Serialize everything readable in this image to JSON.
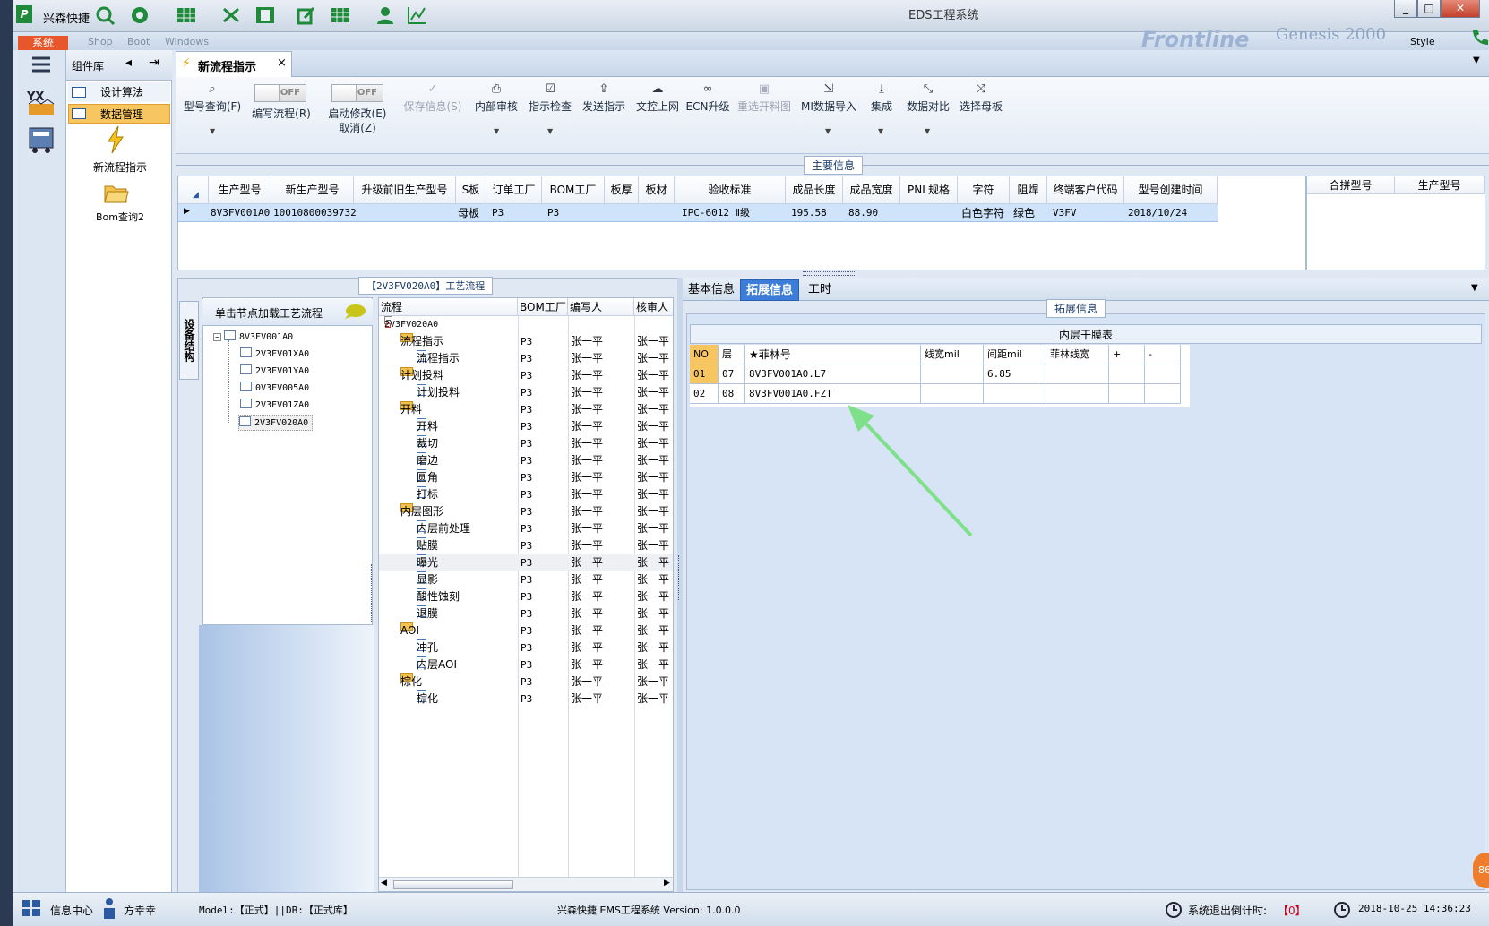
{
  "app": {
    "logo": "P",
    "name": "兴森快捷",
    "window_title": "EDS工程系统",
    "ribbon_tab": "系统",
    "ribbon_menu": [
      "Shop",
      "Boot",
      "Windows"
    ],
    "brand_text": "Frontline",
    "genesis": "Genesis 2000",
    "style_label": "Style",
    "window_buttons": [
      "_",
      "□",
      "✕"
    ]
  },
  "nav": {
    "library_title": "组件库",
    "items": [
      {
        "label": "设计算法",
        "selected": false
      },
      {
        "label": "数据管理",
        "selected": true
      }
    ],
    "tools": [
      {
        "label": "新流程指示",
        "icon": "lightning-icon"
      },
      {
        "label": "Bom查询2",
        "icon": "folder-open-icon"
      }
    ]
  },
  "doc_tab": {
    "label": "新流程指示",
    "close": "×"
  },
  "toolbar": {
    "model_query": "型号查询(F)",
    "edit_flow": "编写流程(R)",
    "enable_modify": "启动修改(E)",
    "cancel": "取消(Z)",
    "toggle_off": "OFF",
    "save_info": "保存信息(S)",
    "internal_review": "内部审核",
    "instruction_check": "指示检查",
    "send_instruction": "发送指示",
    "doc_upload": "文控上网",
    "ecn_upgrade": "ECN升级",
    "reselect_chart": "重选开料图",
    "mi_import": "MI数据导入",
    "integrate": "集成",
    "data_compare": "数据对比",
    "select_master": "选择母板"
  },
  "main_info": {
    "title": "主要信息",
    "columns": [
      "生产型号",
      "新生产型号",
      "升级前旧生产型号",
      "S板",
      "订单工厂",
      "BOM工厂",
      "板厚",
      "板材",
      "验收标准",
      "成品长度",
      "成品宽度",
      "PNL规格",
      "字符",
      "阻焊",
      "终端客户代码",
      "型号创建时间"
    ],
    "row": [
      "8V3FV001A0",
      "10010800039732",
      "",
      "母板",
      "P3",
      "P3",
      "",
      "",
      "IPC-6012 Ⅱ级",
      "195.58",
      "88.90",
      "",
      "白色字符",
      "绿色",
      "V3FV",
      "2018/10/24"
    ],
    "side_columns": [
      "合拼型号",
      "生产型号"
    ]
  },
  "process_flow": {
    "title": "【2V3FV020A0】工艺流程",
    "vertical_tab": "设备结构",
    "load_hint": "单击节点加载工艺流程",
    "tree1": {
      "root": "8V3FV001A0",
      "children": [
        "2V3FV01XA0",
        "2V3FV01YA0",
        "0V3FV005A0",
        "2V3FV01ZA0",
        "2V3FV020A0"
      ]
    },
    "tree2_columns": [
      "流程",
      "BOM工厂",
      "编写人",
      "核审人"
    ],
    "tree2_rows": [
      {
        "name": "2V3FV020A0",
        "level": 0,
        "type": "home",
        "factory": "",
        "writer": "",
        "reviewer": ""
      },
      {
        "name": "流程指示",
        "level": 1,
        "type": "folder",
        "factory": "P3",
        "writer": "张一平",
        "reviewer": "张一平"
      },
      {
        "name": "流程指示",
        "level": 2,
        "type": "doc",
        "factory": "P3",
        "writer": "张一平",
        "reviewer": "张一平"
      },
      {
        "name": "计划投料",
        "level": 1,
        "type": "folder",
        "factory": "P3",
        "writer": "张一平",
        "reviewer": "张一平"
      },
      {
        "name": "计划投料",
        "level": 2,
        "type": "doc",
        "factory": "P3",
        "writer": "张一平",
        "reviewer": "张一平"
      },
      {
        "name": "开料",
        "level": 1,
        "type": "folder",
        "factory": "P3",
        "writer": "张一平",
        "reviewer": "张一平"
      },
      {
        "name": "开料",
        "level": 2,
        "type": "doc",
        "factory": "P3",
        "writer": "张一平",
        "reviewer": "张一平"
      },
      {
        "name": "裁切",
        "level": 2,
        "type": "doc",
        "factory": "P3",
        "writer": "张一平",
        "reviewer": "张一平"
      },
      {
        "name": "磨边",
        "level": 2,
        "type": "doc",
        "factory": "P3",
        "writer": "张一平",
        "reviewer": "张一平"
      },
      {
        "name": "圆角",
        "level": 2,
        "type": "doc",
        "factory": "P3",
        "writer": "张一平",
        "reviewer": "张一平"
      },
      {
        "name": "打标",
        "level": 2,
        "type": "doc",
        "factory": "P3",
        "writer": "张一平",
        "reviewer": "张一平"
      },
      {
        "name": "内层图形",
        "level": 1,
        "type": "folder",
        "factory": "P3",
        "writer": "张一平",
        "reviewer": "张一平"
      },
      {
        "name": "内层前处理",
        "level": 2,
        "type": "doc",
        "factory": "P3",
        "writer": "张一平",
        "reviewer": "张一平"
      },
      {
        "name": "贴膜",
        "level": 2,
        "type": "doc",
        "factory": "P3",
        "writer": "张一平",
        "reviewer": "张一平"
      },
      {
        "name": "曝光",
        "level": 2,
        "type": "doc",
        "factory": "P3",
        "writer": "张一平",
        "reviewer": "张一平"
      },
      {
        "name": "显影",
        "level": 2,
        "type": "doc",
        "factory": "P3",
        "writer": "张一平",
        "reviewer": "张一平"
      },
      {
        "name": "酸性蚀刻",
        "level": 2,
        "type": "doc",
        "factory": "P3",
        "writer": "张一平",
        "reviewer": "张一平"
      },
      {
        "name": "退膜",
        "level": 2,
        "type": "doc",
        "factory": "P3",
        "writer": "张一平",
        "reviewer": "张一平"
      },
      {
        "name": "AOI",
        "level": 1,
        "type": "folder",
        "factory": "P3",
        "writer": "张一平",
        "reviewer": "张一平"
      },
      {
        "name": "冲孔",
        "level": 2,
        "type": "doc",
        "factory": "P3",
        "writer": "张一平",
        "reviewer": "张一平"
      },
      {
        "name": "内层AOI",
        "level": 2,
        "type": "doc",
        "factory": "P3",
        "writer": "张一平",
        "reviewer": "张一平"
      },
      {
        "name": "棕化",
        "level": 1,
        "type": "folder",
        "factory": "P3",
        "writer": "张一平",
        "reviewer": "张一平"
      },
      {
        "name": "棕化",
        "level": 2,
        "type": "doc",
        "factory": "P3",
        "writer": "张一平",
        "reviewer": "张一平"
      }
    ]
  },
  "right_panel": {
    "tabs": [
      "基本信息",
      "拓展信息",
      "工时"
    ],
    "active_tab": "拓展信息",
    "group_title": "拓展信息",
    "table_title": "内层干膜表",
    "columns": [
      "NO",
      "层",
      "★菲林号",
      "线宽mil",
      "间距mil",
      "菲林线宽",
      "+",
      "-"
    ],
    "rows": [
      [
        "01",
        "07",
        "8V3FV001A0.L7",
        "",
        "6.85",
        "",
        "",
        ""
      ],
      [
        "02",
        "08",
        "8V3FV001A0.FZT",
        "",
        "",
        "",
        "",
        ""
      ]
    ]
  },
  "status": {
    "info_center": "信息中心",
    "user": "方幸幸",
    "model": "Model:【正式】||DB:【正式库】",
    "system": "兴森快捷 EMS工程系统 Version: 1.0.0.0",
    "logout_countdown": "系统退出倒计时:",
    "countdown_value": "【0】",
    "datetime": "2018-10-25 14:36:23"
  },
  "colors": {
    "accent": "#2f6fcf",
    "active_tab": "#3b7dd8",
    "selected_nav": "#f8c660",
    "arrow": "#7fe08a",
    "ribbon_tab": "#e8572c"
  }
}
